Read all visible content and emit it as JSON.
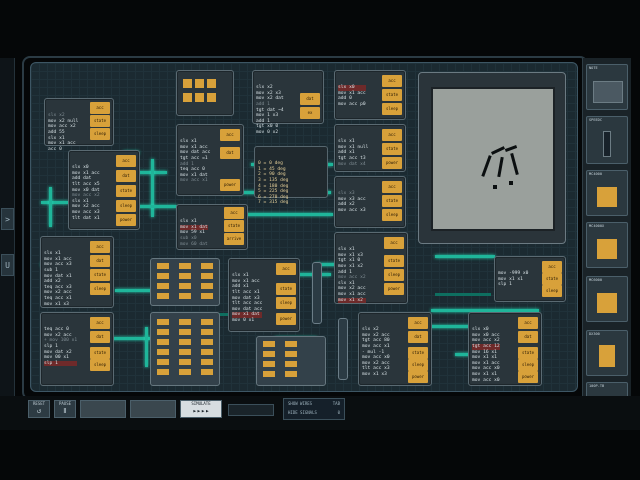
{
  "left_rail": {
    "items": [
      {
        "label": ">"
      },
      {
        "label": "U"
      }
    ]
  },
  "bottom_controls": {
    "reset_label": "RESET",
    "pause_label": "PAUSE",
    "step_label": "",
    "run_label": "",
    "simulate_label": "SIMULATE",
    "reset_sym": "↺",
    "pause_sym": "Ⅱ",
    "simulate_sym": "▸▸▸▸"
  },
  "info_panel": {
    "show_wires_label": "SHOW WIRES",
    "show_wires_value": "TAB",
    "hide_signals_label": "HIDE SIGNALS",
    "hide_signals_value": "0"
  },
  "sidebar": {
    "items": [
      {
        "label": "NOTE"
      },
      {
        "label": "SPEEDC"
      },
      {
        "label": "MC4000"
      },
      {
        "label": "MC4000X"
      },
      {
        "label": "MC6000"
      },
      {
        "label": "DX300"
      },
      {
        "label": "100P-TB"
      }
    ]
  },
  "nodes": [
    {
      "id": "n1",
      "lines": [
        "slx x2",
        "mov x2 null",
        "mov acc x2",
        "add 55",
        "slx x1",
        "mov x1 acc",
        "acc 0"
      ],
      "pads": [
        "acc",
        "dat",
        "state",
        "sleep",
        "power"
      ]
    },
    {
      "id": "n2",
      "lines": [
        "slx x0",
        "mov x1 acc",
        "add dat",
        "tlt acc x5",
        "mov x0 dat",
        "mov acc x2",
        "slx x1",
        "mov x2 acc",
        "mov acc x3",
        "tlt dat x1"
      ],
      "pads": [
        "acc",
        "dat",
        "state",
        "sleep",
        "power"
      ]
    },
    {
      "id": "n3",
      "lines": [
        "slx x1",
        "mov x1 acc",
        "mov dat acc",
        "tgt acc =1",
        "add 1",
        "teq acc 0",
        "mov x1 dat",
        "mov acc x1"
      ],
      "pads": [
        "acc",
        "dat",
        "power"
      ]
    },
    {
      "id": "n4",
      "lines": [
        "slx x1",
        "mov x1 acc",
        "mov x1 dat",
        "mov dat x2",
        "sub 1",
        "teq acc 5",
        "mov acc x0"
      ],
      "pads": [
        "acc",
        "dat",
        "state",
        "sleep",
        "power"
      ]
    },
    {
      "id": "n5",
      "lines": [
        "slx x2",
        "mov x2 x3",
        "mov x2 dat",
        "add 1",
        "tgt dat ~4",
        "mov 1 x3",
        "add 1",
        "tgt x0 0",
        "mov 0 x2"
      ],
      "pads": [
        "dat",
        "ex",
        "power"
      ]
    },
    {
      "id": "n6",
      "lines": [
        "slx x3",
        "mov x3 acc",
        "add x2",
        "mov acc x3"
      ],
      "pads": [
        "acc",
        "state",
        "sleep"
      ]
    },
    {
      "id": "n7",
      "lines": [
        "slx x1",
        "mov x1 null",
        "add x1",
        "tgt acc t3",
        "mov dat x4"
      ],
      "pads": [
        "acc",
        "state",
        "power"
      ]
    },
    {
      "id": "n8",
      "lines": [
        "slx x0",
        "mov x1 acc",
        "add 0",
        "mov acc p0"
      ],
      "pads": [
        "acc",
        "state",
        "sleep",
        "power"
      ]
    },
    {
      "id": "n9",
      "lines": [
        "slx x1",
        "mov x1 dat",
        "mov 59 x1",
        "sub x0",
        "mov 60 dat"
      ],
      "pads": [
        "acc",
        "state",
        "arrive",
        "power"
      ]
    },
    {
      "id": "n10",
      "lines": [
        "slx x1",
        "mov x1 acc",
        "mov acc x3",
        "sub 1",
        "mov dat x1",
        "add x2",
        "teq acc x3",
        "mov x2 acc",
        "teq acc x1",
        "mov x1 x3"
      ],
      "pads": [
        "acc",
        "dat",
        "state",
        "sleep",
        "power"
      ]
    },
    {
      "id": "n11",
      "lines": [
        "slx x1",
        "mov x1 x3",
        "tgt x1 0",
        "mov x1 x2",
        "add 1",
        "mov acc x2",
        "slx x1",
        "mov x2 acc",
        "mov x1 acc",
        "mov x1 x2"
      ],
      "pads": [
        "acc",
        "state",
        "sleep",
        "power"
      ]
    },
    {
      "id": "n12",
      "lines": [
        "slx x1",
        "mov x1 acc",
        "add x1",
        "tlt acc x1",
        "mov dat x3",
        "tlt acc acc",
        "mov dat acc",
        "mov x1 dat",
        "mov 0 x1"
      ],
      "pads": [
        "acc",
        "state",
        "sleep",
        "power"
      ]
    },
    {
      "id": "n13",
      "lines": [
        "mov -999 x0",
        "mov x1 x1",
        "slp 1"
      ],
      "pads": [
        "acc",
        "state",
        "sleep"
      ]
    },
    {
      "id": "n14",
      "lines": [
        "teq acc 0",
        "mov x2 acc",
        "+ mov 100 x1",
        "slp 1",
        "mov dat x2",
        "mov 00 x1",
        "slp 1"
      ],
      "pads": [
        "acc",
        "dat",
        "state",
        "sleep",
        "power"
      ]
    },
    {
      "id": "n15",
      "lines": [
        "slx x2",
        "mov x2 acc",
        "tgt acc 80",
        "mov acc x1",
        "- mul -1",
        "mov acc x0",
        "mov x2 acc",
        "tlt acc x3",
        "mov x1 x3"
      ],
      "pads": [
        "acc",
        "dat",
        "state",
        "sleep",
        "power"
      ]
    },
    {
      "id": "n16",
      "lines": [
        "slx x0",
        "mov x0 acc",
        "mov acc x2",
        "tgt acc 12",
        "mov 16 x1",
        "mov x1 x1",
        "mov x1 acc",
        "mov acc x0",
        "mov x1 x1",
        "mov acc x0"
      ],
      "pads": [
        "acc",
        "dat",
        "state",
        "sleep",
        "power"
      ]
    }
  ],
  "stack_list": {
    "rows": [
      "0 = 0 deg",
      "1 = 45 deg",
      "2 = 90 deg",
      "3 = 135 deg",
      "4 = 180 deg",
      "5 = 225 deg",
      "6 = 270 deg",
      "7 = 315 deg"
    ]
  }
}
